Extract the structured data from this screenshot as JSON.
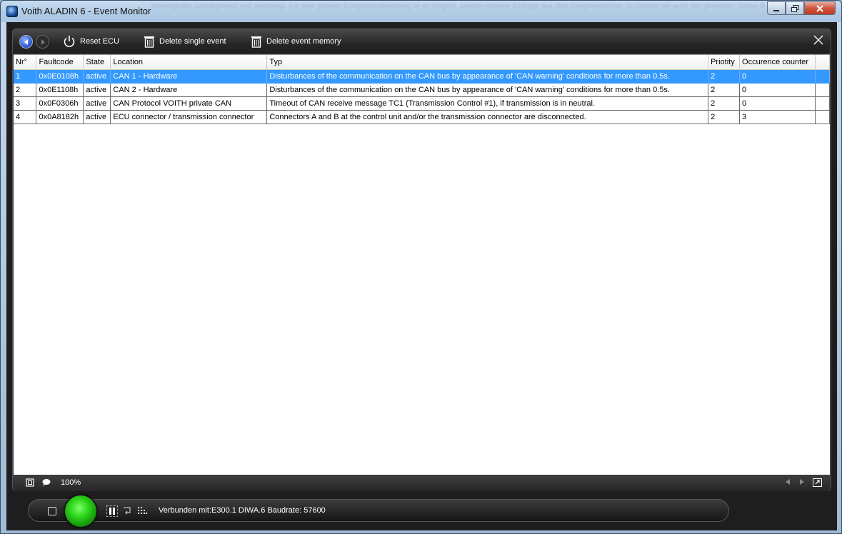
{
  "window": {
    "title": "Voith ALADIN 6 - Event Monitor",
    "background_text": "Steuergeräte zurückgesetzt und angezeigt. Für eine gezielte Ereignisbeobachtung ist es möglich, sowohl einzelne Einträge aus dem Ereignisspeicher zu löschen als auch den gesamten Status des Ereignisspeichers erstellt werden. Ein Reset des Getriebe-Steuergeräts ist ebenso möglich."
  },
  "toolbar": {
    "reset_label": "Reset ECU",
    "delete_single_label": "Delete single event",
    "delete_memory_label": "Delete event memory"
  },
  "table": {
    "headers": [
      "Nr°",
      "Faultcode",
      "State",
      "Location",
      "Typ",
      "Priotity",
      "Occurence counter"
    ],
    "rows": [
      [
        "1",
        "0x0E0108h",
        "active",
        "CAN 1 - Hardware",
        "Disturbances of the communication on the CAN bus by appearance of 'CAN warning' conditions for more than 0.5s.",
        "2",
        "0"
      ],
      [
        "2",
        "0x0E1108h",
        "active",
        "CAN 2 - Hardware",
        "Disturbances of the communication on the CAN bus by appearance of 'CAN warning' conditions for more than 0.5s.",
        "2",
        "0"
      ],
      [
        "3",
        "0x0F0306h",
        "active",
        "CAN Protocol VOITH private CAN",
        "Timeout of CAN receive message TC1 (Transmission Control #1), if transmission is in neutral.",
        "2",
        "0"
      ],
      [
        "4",
        "0x0A8182h",
        "active",
        "ECU connector / transmission connector",
        "Connectors A and B at the control unit and/or the transmission connector are disconnected.",
        "2",
        "3"
      ]
    ],
    "selected_row": 0
  },
  "statusbar": {
    "zoom": "100%"
  },
  "bottombar": {
    "connection": "Verbunden mit:E300.1  DIWA.6 Baudrate: 57600",
    "led_color": "#2fd61c"
  },
  "colors": {
    "selection": "#3399ff",
    "toolbar_bg": "#262626"
  }
}
